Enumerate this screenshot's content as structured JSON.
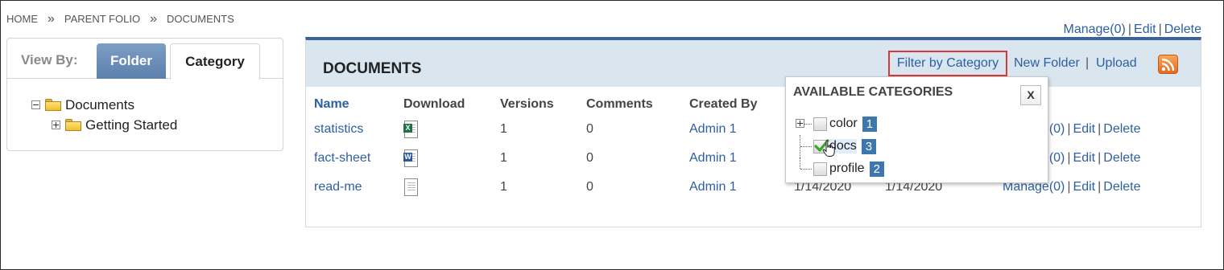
{
  "breadcrumb": {
    "items": [
      "HOME",
      "PARENT FOLIO",
      "DOCUMENTS"
    ],
    "separator": "»"
  },
  "top_actions": {
    "manage": "Manage(0)",
    "edit": "Edit",
    "delete": "Delete",
    "separator": "|"
  },
  "view_by": {
    "label": "View By:",
    "tabs": [
      {
        "label": "Folder",
        "active": true
      },
      {
        "label": "Category",
        "active": false
      }
    ]
  },
  "folder_tree": {
    "root": {
      "label": "Documents",
      "expanded": true
    },
    "children": [
      {
        "label": "Getting Started",
        "expanded": false
      }
    ]
  },
  "documents": {
    "title": "DOCUMENTS",
    "filter_label": "Filter by Category",
    "new_folder_label": "New Folder",
    "upload_label": "Upload",
    "header_separator": "|",
    "columns": [
      "Name",
      "Download",
      "Versions",
      "Comments",
      "Created By"
    ],
    "rows": [
      {
        "name": "statistics",
        "file_type": "excel",
        "file_icon": "excel-file-icon",
        "versions": "1",
        "comments": "0",
        "created_by": "Admin 1",
        "created": "",
        "modified": "",
        "manage": "Manage(0)",
        "edit": "Edit",
        "delete": "Delete"
      },
      {
        "name": "fact-sheet",
        "file_type": "word",
        "file_icon": "word-file-icon",
        "versions": "1",
        "comments": "0",
        "created_by": "Admin 1",
        "created": "",
        "modified": "",
        "manage": "Manage(0)",
        "edit": "Edit",
        "delete": "Delete"
      },
      {
        "name": "read-me",
        "file_type": "text",
        "file_icon": "text-file-icon",
        "versions": "1",
        "comments": "0",
        "created_by": "Admin 1",
        "created": "1/14/2020",
        "modified": "1/14/2020",
        "manage": "Manage(0)",
        "edit": "Edit",
        "delete": "Delete"
      }
    ]
  },
  "category_popup": {
    "title": "AVAILABLE CATEGORIES",
    "close_label": "X",
    "categories": [
      {
        "label": "color",
        "count": "1",
        "checked": false,
        "expandable": true
      },
      {
        "label": "docs",
        "count": "3",
        "checked": true,
        "expandable": false
      },
      {
        "label": "profile",
        "count": "2",
        "checked": false,
        "expandable": false
      }
    ]
  },
  "colors": {
    "link": "#2d5fa3",
    "header_bg": "#d9e6ef",
    "panel_top_border": "#3c6299",
    "filter_highlight": "#d9383a",
    "badge": "#3c77ad",
    "rss": "#e6691d"
  }
}
